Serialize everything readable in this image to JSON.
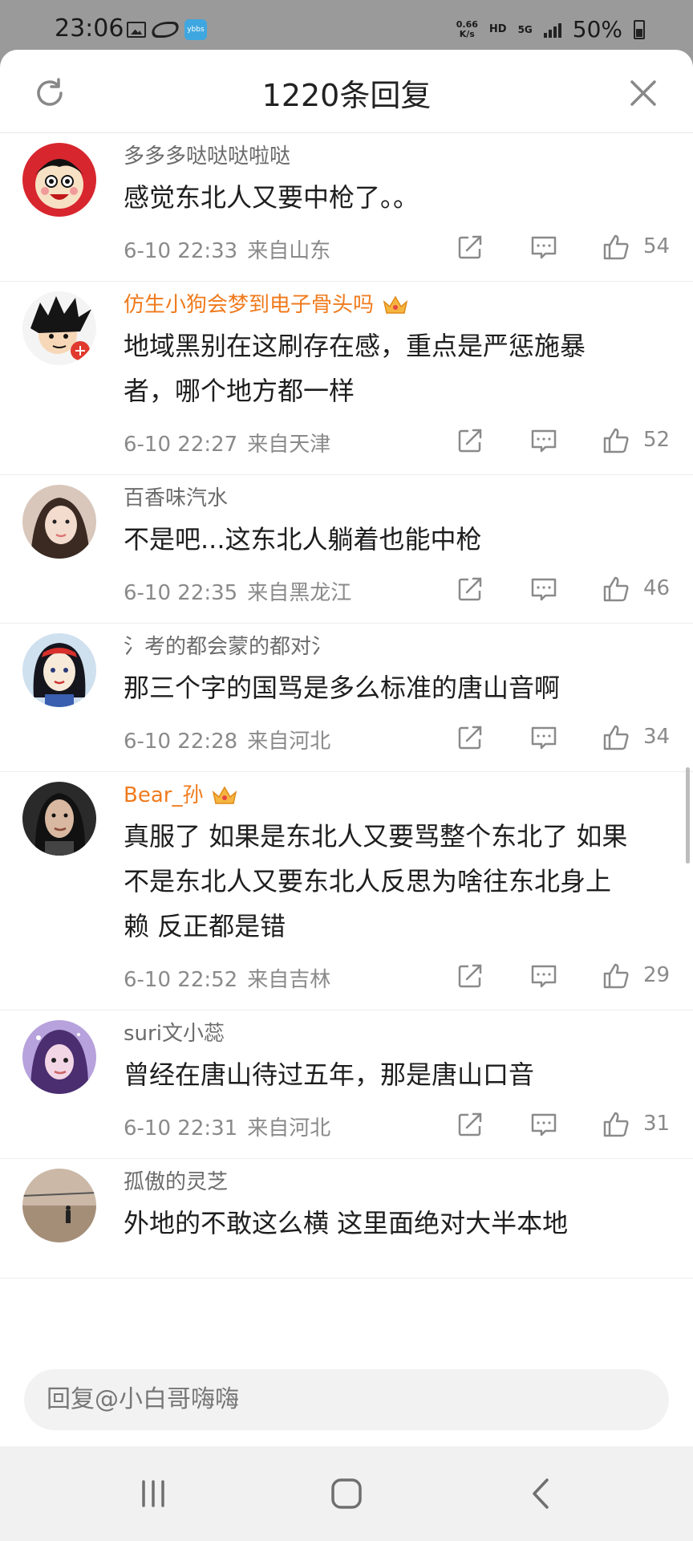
{
  "status": {
    "time": "23:06",
    "app_badge": "ybbs",
    "speed_value": "0.66",
    "speed_unit": "K/s",
    "hd": "HD",
    "network": "5G",
    "battery": "50%"
  },
  "header": {
    "title": "1220条回复",
    "refresh_icon": "refresh-icon",
    "close_icon": "close-icon"
  },
  "comments": [
    {
      "name": "多多多哒哒哒啦哒",
      "vip": false,
      "text": [
        "感觉东北人又要中枪了。。"
      ],
      "date": "6-10 22:33",
      "location": "来自山东",
      "likes": "54"
    },
    {
      "name": "仿生小狗会梦到电子骨头吗",
      "vip": true,
      "text": [
        "地域黑别在这刷存在感，重点是严惩施暴",
        "者，哪个地方都一样"
      ],
      "date": "6-10 22:27",
      "location": "来自天津",
      "likes": "52"
    },
    {
      "name": "百香味汽水",
      "vip": false,
      "text": [
        "不是吧...这东北人躺着也能中枪"
      ],
      "date": "6-10 22:35",
      "location": "来自黑龙江",
      "likes": "46"
    },
    {
      "name": "氵考的都会蒙的都对氵",
      "vip": false,
      "text": [
        "那三个字的国骂是多么标准的唐山音啊"
      ],
      "date": "6-10 22:28",
      "location": "来自河北",
      "likes": "34"
    },
    {
      "name": "Bear_孙",
      "vip": true,
      "text": [
        "真服了 如果是东北人又要骂整个东北了 如果",
        "不是东北人又要东北人反思为啥往东北身上",
        "赖 反正都是错"
      ],
      "date": "6-10 22:52",
      "location": "来自吉林",
      "likes": "29"
    },
    {
      "name": "suri文小蕊",
      "vip": false,
      "text": [
        "曾经在唐山待过五年，那是唐山口音"
      ],
      "date": "6-10 22:31",
      "location": "来自河北",
      "likes": "31"
    },
    {
      "name": "孤傲的灵芝",
      "vip": false,
      "text": [
        "外地的不敢这么横 这里面绝对大半本地"
      ],
      "date": "",
      "location": "",
      "likes": ""
    }
  ],
  "reply": {
    "placeholder": "回复@小白哥嗨嗨"
  },
  "nav": {
    "recent_icon": "recent-apps-icon",
    "home_icon": "home-icon",
    "back_icon": "back-icon"
  },
  "colors": {
    "vip_name": "#f07a1c",
    "name": "#6b6b6b",
    "meta": "#8a8a8a"
  }
}
